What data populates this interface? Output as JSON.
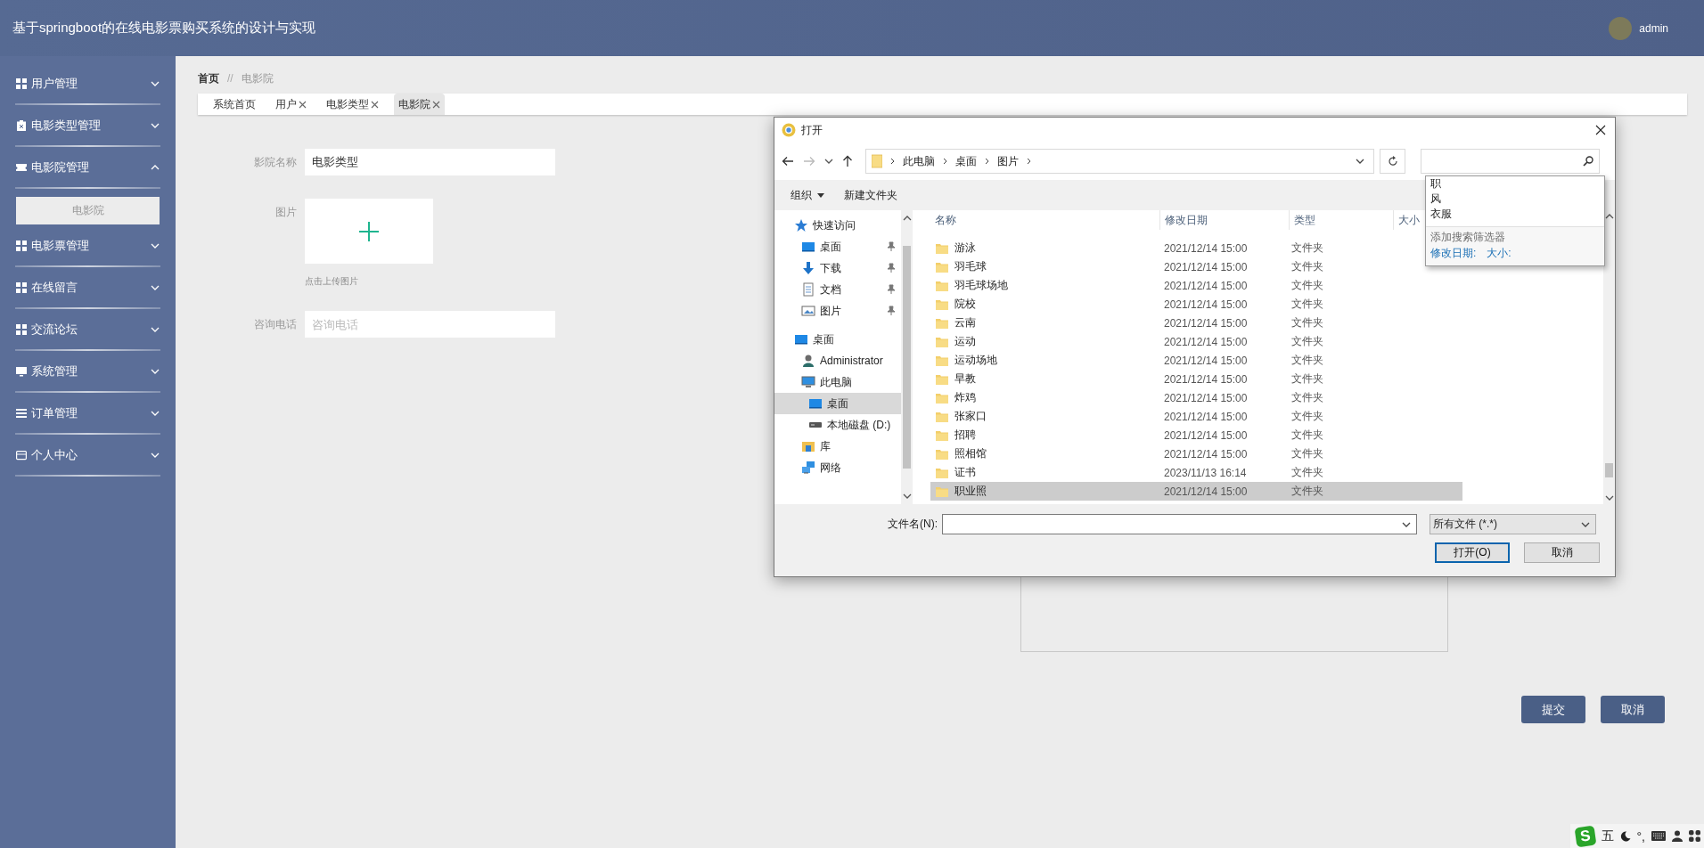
{
  "header": {
    "title": "基于springboot的在线电影票购买系统的设计与实现",
    "user": "admin"
  },
  "sidebar": {
    "items": [
      {
        "label": "用户管理",
        "expanded": false
      },
      {
        "label": "电影类型管理",
        "expanded": false
      },
      {
        "label": "电影院管理",
        "expanded": true,
        "children": [
          {
            "label": "电影院",
            "selected": true
          }
        ]
      },
      {
        "label": "电影票管理",
        "expanded": false
      },
      {
        "label": "在线留言",
        "expanded": false
      },
      {
        "label": "交流论坛",
        "expanded": false
      },
      {
        "label": "系统管理",
        "expanded": false
      },
      {
        "label": "订单管理",
        "expanded": false
      },
      {
        "label": "个人中心",
        "expanded": false
      }
    ]
  },
  "breadcrumb": {
    "separator": "//",
    "items": [
      {
        "label": "首页",
        "current": false
      },
      {
        "label": "电影院",
        "current": true
      }
    ]
  },
  "tabs": [
    {
      "label": "系统首页",
      "closable": false,
      "selected": false
    },
    {
      "label": "用户",
      "closable": true,
      "selected": false
    },
    {
      "label": "电影类型",
      "closable": true,
      "selected": false
    },
    {
      "label": "电影院",
      "closable": true,
      "selected": true
    }
  ],
  "form": {
    "fields": [
      {
        "kind": "text",
        "label": "影院名称",
        "value": "电影类型"
      },
      {
        "kind": "upload",
        "label": "图片",
        "hint": "点击上传图片"
      },
      {
        "kind": "text",
        "label": "咨询电话",
        "placeholder": "咨询电话"
      }
    ],
    "buttons": [
      {
        "label": "提交"
      },
      {
        "label": "取消"
      }
    ]
  },
  "dialog": {
    "title": "打开",
    "address": [
      "此电脑",
      "桌面",
      "图片"
    ],
    "toolbar": [
      {
        "label": "组织",
        "kind": "menu"
      },
      {
        "label": "新建文件夹",
        "kind": "button"
      }
    ],
    "nav_tree": [
      {
        "label": "快速访问",
        "selected": false,
        "children": [
          {
            "label": "桌面",
            "pinned": true,
            "selected": false
          },
          {
            "label": "下载",
            "pinned": true,
            "selected": false
          },
          {
            "label": "文档",
            "pinned": true,
            "selected": false
          },
          {
            "label": "图片",
            "pinned": true,
            "selected": false
          }
        ]
      },
      {
        "label": "桌面",
        "selected": false,
        "children": [
          {
            "label": "Administrator",
            "selected": false
          },
          {
            "label": "此电脑",
            "selected": false,
            "children": [
              {
                "label": "桌面",
                "selected": true
              },
              {
                "label": "本地磁盘 (D:)",
                "selected": false
              }
            ]
          },
          {
            "label": "库",
            "selected": false
          },
          {
            "label": "网络",
            "selected": false
          }
        ]
      }
    ],
    "columns": [
      "名称",
      "修改日期",
      "类型",
      "大小"
    ],
    "files": [
      {
        "name": "游泳",
        "modified": "2021/12/14 15:00",
        "type": "文件夹",
        "selected": false
      },
      {
        "name": "羽毛球",
        "modified": "2021/12/14 15:00",
        "type": "文件夹",
        "selected": false
      },
      {
        "name": "羽毛球场地",
        "modified": "2021/12/14 15:00",
        "type": "文件夹",
        "selected": false
      },
      {
        "name": "院校",
        "modified": "2021/12/14 15:00",
        "type": "文件夹",
        "selected": false
      },
      {
        "name": "云南",
        "modified": "2021/12/14 15:00",
        "type": "文件夹",
        "selected": false
      },
      {
        "name": "运动",
        "modified": "2021/12/14 15:00",
        "type": "文件夹",
        "selected": false
      },
      {
        "name": "运动场地",
        "modified": "2021/12/14 15:00",
        "type": "文件夹",
        "selected": false
      },
      {
        "name": "早教",
        "modified": "2021/12/14 15:00",
        "type": "文件夹",
        "selected": false
      },
      {
        "name": "炸鸡",
        "modified": "2021/12/14 15:00",
        "type": "文件夹",
        "selected": false
      },
      {
        "name": "张家口",
        "modified": "2021/12/14 15:00",
        "type": "文件夹",
        "selected": false
      },
      {
        "name": "招聘",
        "modified": "2021/12/14 15:00",
        "type": "文件夹",
        "selected": false
      },
      {
        "name": "照相馆",
        "modified": "2021/12/14 15:00",
        "type": "文件夹",
        "selected": false
      },
      {
        "name": "证书",
        "modified": "2023/11/13 16:14",
        "type": "文件夹",
        "selected": false
      },
      {
        "name": "职业照",
        "modified": "2021/12/14 15:00",
        "type": "文件夹",
        "selected": true
      }
    ],
    "search": {
      "suggestions": [
        "职",
        "风",
        "衣服"
      ],
      "filter_hint": "添加搜索筛选器",
      "filters": [
        "修改日期:",
        "大小:"
      ]
    },
    "filename_label": "文件名(N):",
    "file_type": "所有文件 (*.*)",
    "buttons": [
      {
        "label": "打开(O)",
        "default": true
      },
      {
        "label": "取消",
        "default": false
      }
    ]
  },
  "ime": {
    "logo": "S",
    "mode": "五",
    "punctuation": "°,"
  }
}
